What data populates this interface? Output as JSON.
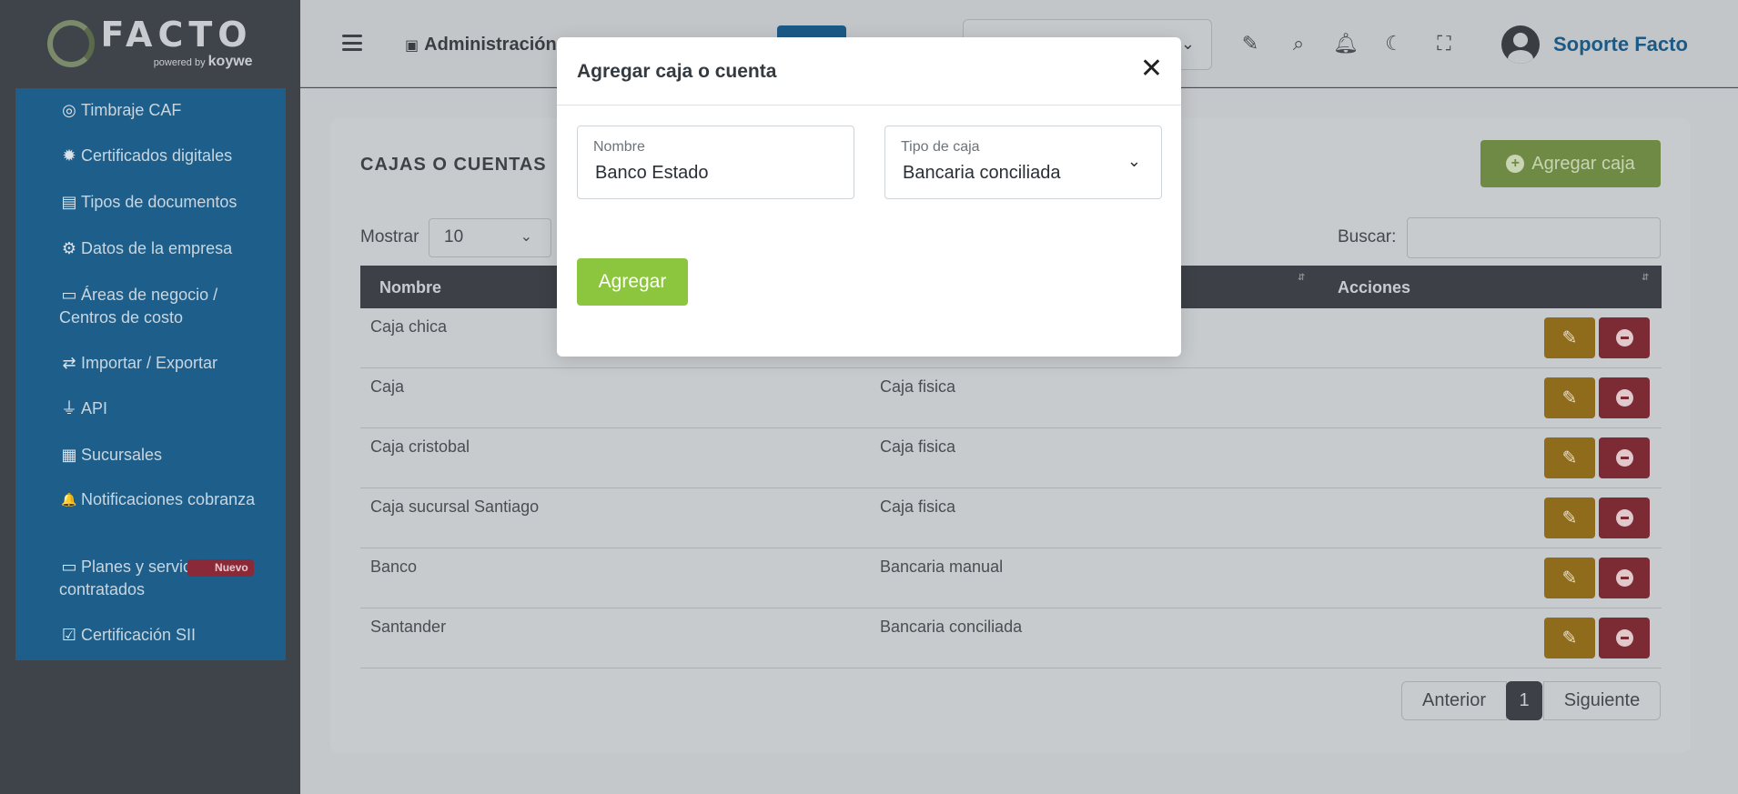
{
  "logo": {
    "text": "FACTO",
    "powered": "powered",
    "by": "by",
    "brand": "koywe"
  },
  "sidebar": {
    "items": [
      {
        "label": "Timbraje CAF",
        "icon": "target-icon",
        "glyph": "◎"
      },
      {
        "label": "Certificados digitales",
        "icon": "certificate-seal-icon",
        "glyph": "✹"
      },
      {
        "label": "Tipos de documentos",
        "icon": "document-icon",
        "glyph": "▤"
      },
      {
        "label": "Datos de la empresa",
        "icon": "gear-icon",
        "glyph": "⚙"
      },
      {
        "label": "Áreas de negocio / Centros de costo",
        "icon": "archive-box-icon",
        "glyph": "▭"
      },
      {
        "label": "Importar / Exportar",
        "icon": "exchange-arrows-icon",
        "glyph": "⇄"
      },
      {
        "label": "API",
        "icon": "plug-icon",
        "glyph": "⏚"
      },
      {
        "label": "Sucursales",
        "icon": "building-icon",
        "glyph": "▦"
      },
      {
        "label": "Notificaciones cobranza",
        "icon": "bell-icon",
        "glyph": "🔔"
      },
      {
        "label": "Planes y servic",
        "label2": "contratados",
        "badge": "Nuevo",
        "icon": "money-bill-icon",
        "glyph": "▭"
      },
      {
        "label": "Certificación SII",
        "icon": "check-square-icon",
        "glyph": "☑"
      }
    ]
  },
  "topbar": {
    "admin_label": "Administración",
    "username": "Soporte Facto",
    "company_select_value": "",
    "icons": [
      "signature-icon",
      "search-icon",
      "bell-icon",
      "moon-icon",
      "fullscreen-icon"
    ]
  },
  "page": {
    "title": "CAJAS O CUENTAS",
    "add_button": "Agregar caja",
    "show_label": "Mostrar",
    "page_length": "10",
    "search_label": "Buscar:",
    "search_value": ""
  },
  "table": {
    "headers": {
      "name": "Nombre",
      "actions": "Acciones"
    },
    "rows": [
      {
        "name": "Caja chica",
        "type": ""
      },
      {
        "name": "Caja",
        "type": "Caja fisica"
      },
      {
        "name": "Caja cristobal",
        "type": "Caja fisica"
      },
      {
        "name": "Caja sucursal Santiago",
        "type": "Caja fisica"
      },
      {
        "name": "Banco",
        "type": "Bancaria manual"
      },
      {
        "name": "Santander",
        "type": "Bancaria conciliada"
      }
    ]
  },
  "pagination": {
    "prev": "Anterior",
    "current": "1",
    "next": "Siguiente"
  },
  "modal": {
    "title": "Agregar caja o cuenta",
    "close": "✕",
    "name_label": "Nombre",
    "name_value": "Banco Estado",
    "type_label": "Tipo de caja",
    "type_value": "Bancaria conciliada",
    "submit": "Agregar"
  },
  "colors": {
    "sidebar_menu": "#1d5f8a",
    "overlay_tint": "#c5c8cb",
    "edit_button": "#8f6c1b",
    "delete_button": "#7c2a34",
    "modal_submit": "#8cc63f",
    "brand_blue": "#1b5a86"
  }
}
